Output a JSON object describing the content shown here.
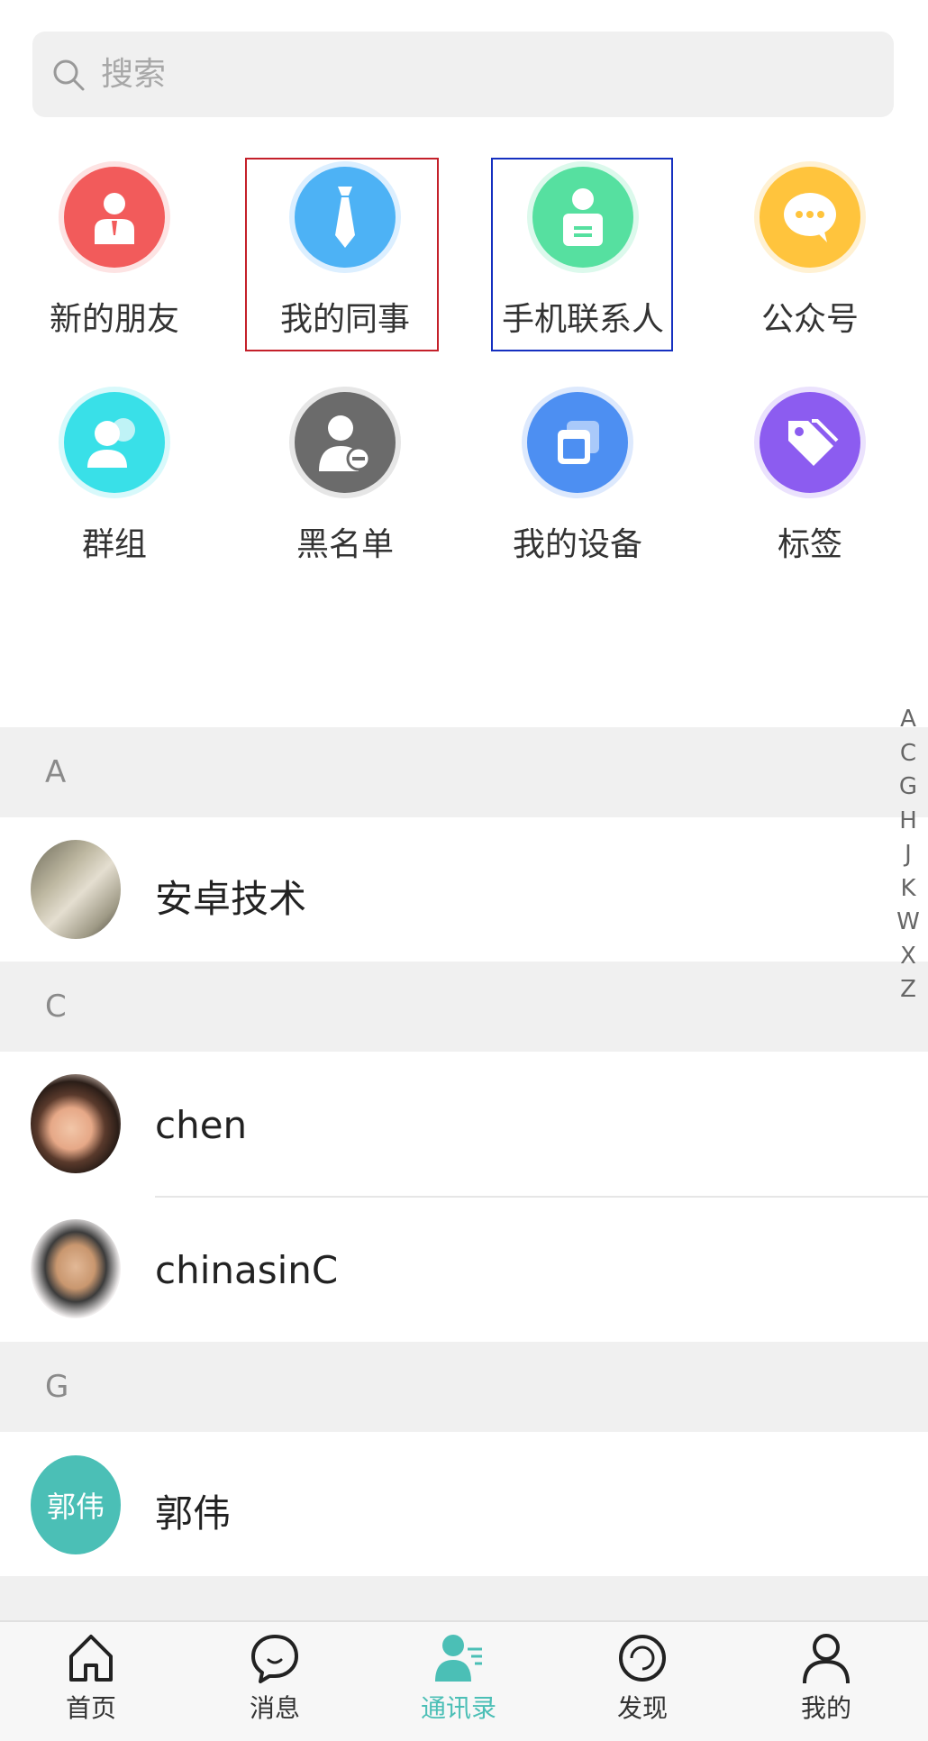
{
  "search": {
    "placeholder": "搜索"
  },
  "features": [
    {
      "label": "新的朋友",
      "icon": "new-friend-icon",
      "color": "#f25b5b"
    },
    {
      "label": "我的同事",
      "icon": "tie-icon",
      "color": "#4db2f5"
    },
    {
      "label": "手机联系人",
      "icon": "contact-card-icon",
      "color": "#56e0a0"
    },
    {
      "label": "公众号",
      "icon": "chat-bubble-icon",
      "color": "#ffc43d"
    },
    {
      "label": "群组",
      "icon": "group-icon",
      "color": "#39e0e8"
    },
    {
      "label": "黑名单",
      "icon": "blacklist-icon",
      "color": "#6b6b6b"
    },
    {
      "label": "我的设备",
      "icon": "device-icon",
      "color": "#4d8ff2"
    },
    {
      "label": "标签",
      "icon": "tag-icon",
      "color": "#8c5cf0"
    }
  ],
  "sections": [
    {
      "letter": "A",
      "contacts": [
        {
          "name": "安卓技术"
        }
      ]
    },
    {
      "letter": "C",
      "contacts": [
        {
          "name": "chen"
        },
        {
          "name": "chinasinC"
        }
      ]
    },
    {
      "letter": "G",
      "contacts": [
        {
          "name": "郭伟",
          "avatar_text": "郭伟",
          "avatar_color": "#4bbfb6"
        }
      ]
    }
  ],
  "index_letters": [
    "A",
    "C",
    "G",
    "H",
    "J",
    "K",
    "W",
    "X",
    "Z"
  ],
  "nav": [
    {
      "label": "首页",
      "icon": "home-icon",
      "active": false
    },
    {
      "label": "消息",
      "icon": "message-icon",
      "active": false
    },
    {
      "label": "通讯录",
      "icon": "contacts-icon",
      "active": true
    },
    {
      "label": "发现",
      "icon": "discover-icon",
      "active": false
    },
    {
      "label": "我的",
      "icon": "profile-icon",
      "active": false
    }
  ],
  "accent_color": "#4bbfb6"
}
